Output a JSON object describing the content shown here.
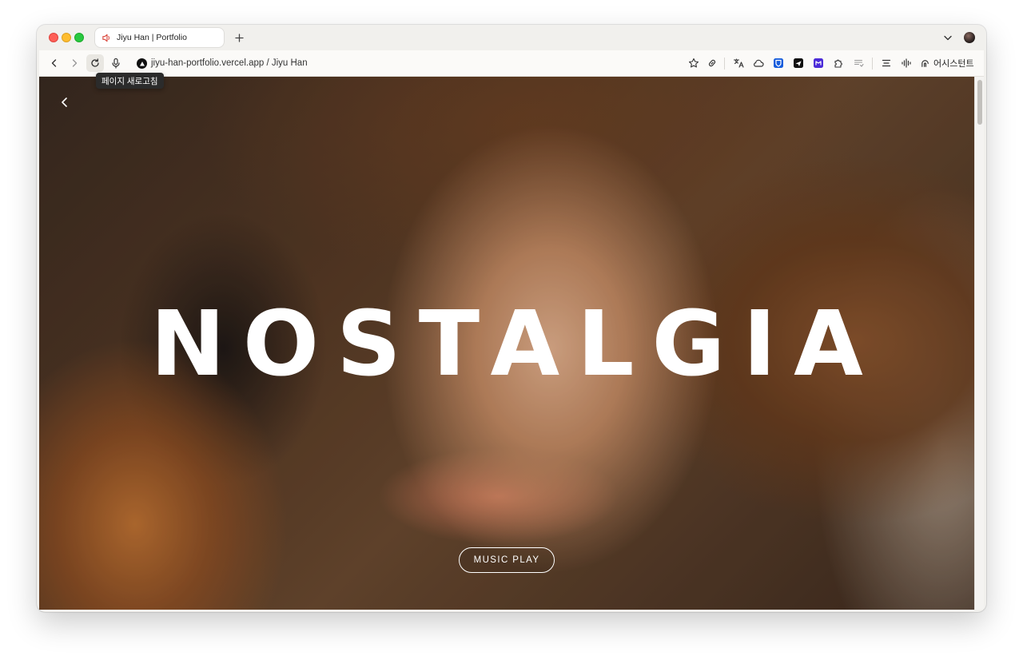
{
  "browser": {
    "tab": {
      "title": "Jiyu Han | Portfolio",
      "audio_icon": "speaker-icon"
    },
    "new_tab_icon": "plus-icon",
    "toolbar": {
      "back_icon": "chevron-left-icon",
      "forward_icon": "chevron-right-icon",
      "reload_icon": "reload-icon",
      "voice_icon": "microphone-icon",
      "site_icon": "triangle-logo-icon",
      "url": "jiyu-han-portfolio.vercel.app / Jiyu Han",
      "extensions": [
        "star-icon",
        "link-icon",
        "translate-icon",
        "cloud-icon",
        "bitwarden-icon",
        "send-icon",
        "extension-purple-icon",
        "puzzle-icon",
        "reader-icon",
        "menu-lines-icon",
        "audio-wave-icon"
      ],
      "assistant_label": "어시스턴트"
    },
    "tooltip": "페이지 새로고침",
    "accent_colors": {
      "close": "#fe5f57",
      "minimize": "#febc2e",
      "maximize": "#28c840"
    }
  },
  "page": {
    "back_icon": "chevron-left-icon",
    "hero_title": "NOSTALGIA",
    "music_button": "MUSIC PLAY"
  }
}
